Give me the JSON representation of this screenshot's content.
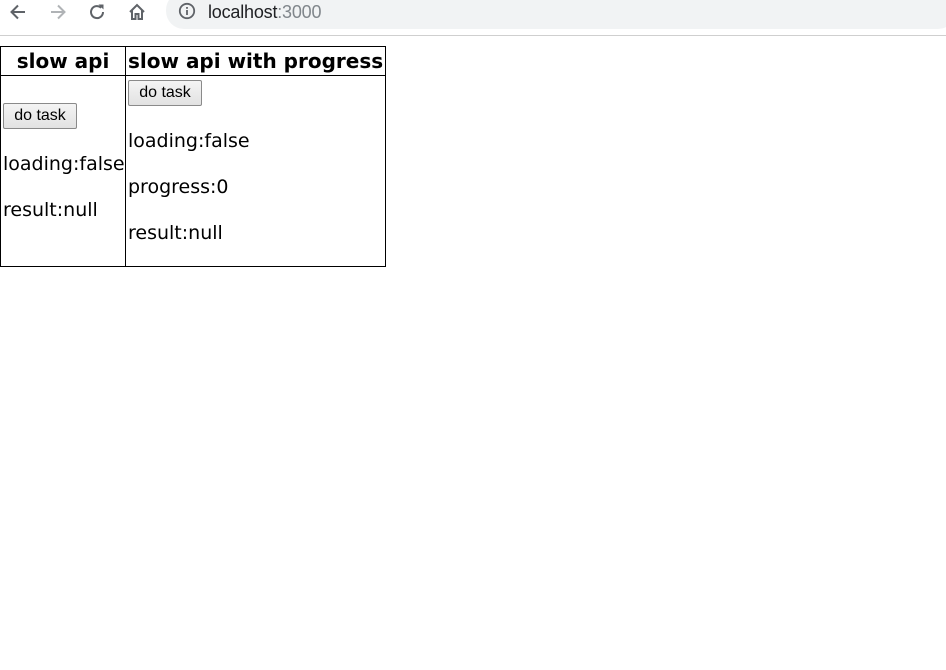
{
  "browser": {
    "url_host": "localhost",
    "url_port": ":3000",
    "icons": [
      "back-arrow-icon",
      "forward-arrow-icon",
      "reload-icon",
      "home-icon",
      "info-icon"
    ]
  },
  "table": {
    "headers": [
      "slow api",
      "slow api with progress"
    ],
    "slow_api": {
      "button_label": "do task",
      "loading": "loading:false",
      "result": "result:null"
    },
    "slow_api_progress": {
      "button_label": "do task",
      "loading": "loading:false",
      "progress": "progress:0",
      "result": "result:null"
    }
  }
}
